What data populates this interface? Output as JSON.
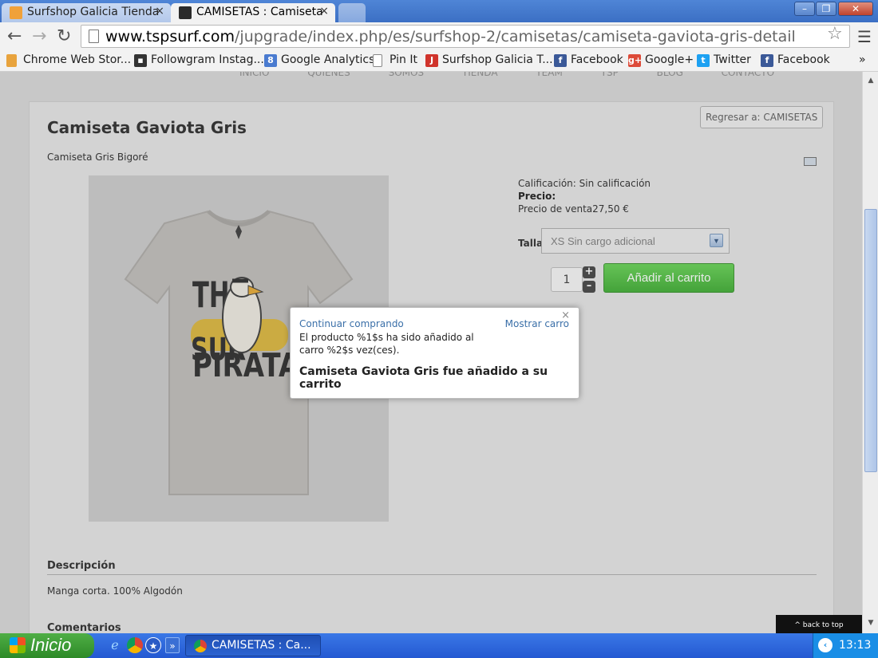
{
  "browser": {
    "tabs": [
      {
        "label": "Surfshop Galicia Tienda",
        "active": false
      },
      {
        "label": "CAMISETAS : Camiseta",
        "active": true
      }
    ],
    "url_host": "www.tspsurf.com",
    "url_path": "/jupgrade/index.php/es/surfshop-2/camisetas/camiseta-gaviota-gris-detail",
    "bookmarks": [
      {
        "label": "Chrome Web Stor...",
        "icon": "chrome-store-icon",
        "color": "#e8a33d"
      },
      {
        "label": "Followgram Instag...",
        "icon": "followgram-icon",
        "color": "#333333"
      },
      {
        "label": "Google Analytics",
        "icon": "google-analytics-icon",
        "color": "#4a7bd0"
      },
      {
        "label": "Pin It",
        "icon": "page-icon",
        "color": "#ffffff"
      },
      {
        "label": "Surfshop Galicia T...",
        "icon": "joomla-icon",
        "color": "#d0342c"
      },
      {
        "label": "Facebook",
        "icon": "facebook-icon",
        "color": "#3b5998"
      },
      {
        "label": "Google+",
        "icon": "google-plus-icon",
        "color": "#dd4b39"
      },
      {
        "label": "Twitter",
        "icon": "twitter-icon",
        "color": "#1da1f2"
      },
      {
        "label": "Facebook",
        "icon": "facebook-icon",
        "color": "#3b5998"
      }
    ],
    "bookmarks_more": "»"
  },
  "page": {
    "top_menu": "INICIO QUIÉNES SOMOS TIENDA TEAM TSP BLOG CONTACTO",
    "back_button": "Regresar a: CAMISETAS",
    "product_title": "Camiseta Gaviota Gris",
    "short_description": "Camiseta Gris Bigoré",
    "rating_label": "Calificación: Sin calificación",
    "price_label": "Precio:",
    "sale_price": "Precio de venta27,50 €",
    "size_label": "Talla",
    "size_selected": "XS Sin cargo adicional",
    "quantity": "1",
    "add_to_cart": "Añadir al carrito",
    "description_heading": "Descripción",
    "description_text": "Manga corta. 100% Algodón",
    "comments_heading": "Comentarios",
    "back_to_top": "^ back to top",
    "accent_green": "#3fb22f"
  },
  "popup": {
    "continue": "Continuar comprando",
    "show_cart": "Mostrar carro",
    "message": "El producto %1$s ha sido añadido al carro %2$s vez(ces).",
    "added": "Camiseta Gaviota Gris fue añadido a su carrito",
    "close": "×"
  },
  "taskbar": {
    "start": "Inicio",
    "task": "CAMISETAS : Ca...",
    "clock": "13:13"
  }
}
